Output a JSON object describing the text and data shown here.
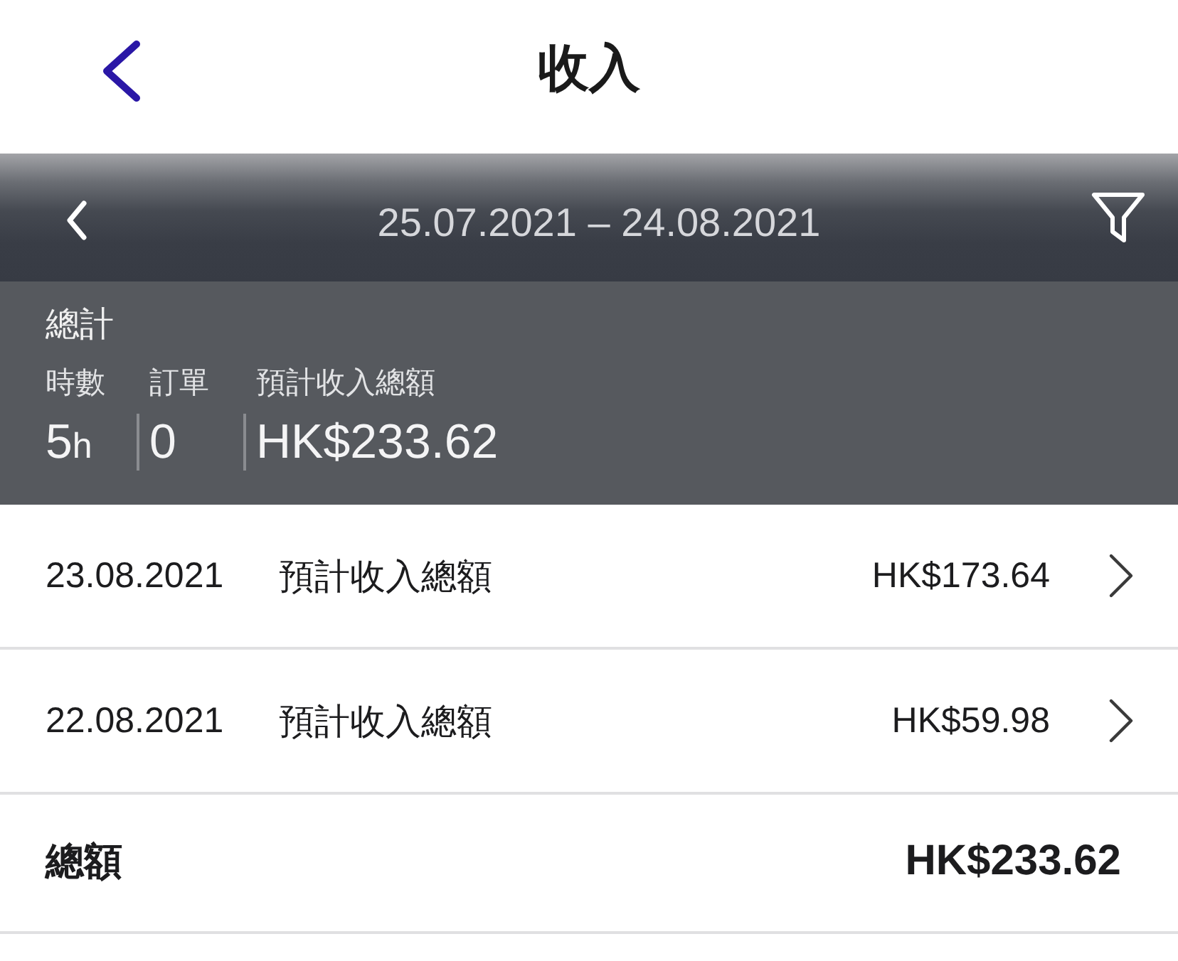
{
  "nav": {
    "title": "收入"
  },
  "period": {
    "range": "25.07.2021 – 24.08.2021"
  },
  "summary": {
    "title": "總計",
    "stats": [
      {
        "label": "時數",
        "value": "5",
        "unit": "h"
      },
      {
        "label": "訂單",
        "value": "0"
      },
      {
        "label": "預計收入總額",
        "value": "HK$233.62"
      }
    ]
  },
  "entries": [
    {
      "date": "23.08.2021",
      "label": "預計收入總額",
      "amount": "HK$173.64"
    },
    {
      "date": "22.08.2021",
      "label": "預計收入總額",
      "amount": "HK$59.98"
    }
  ],
  "total": {
    "label": "總額",
    "amount": "HK$233.62"
  }
}
